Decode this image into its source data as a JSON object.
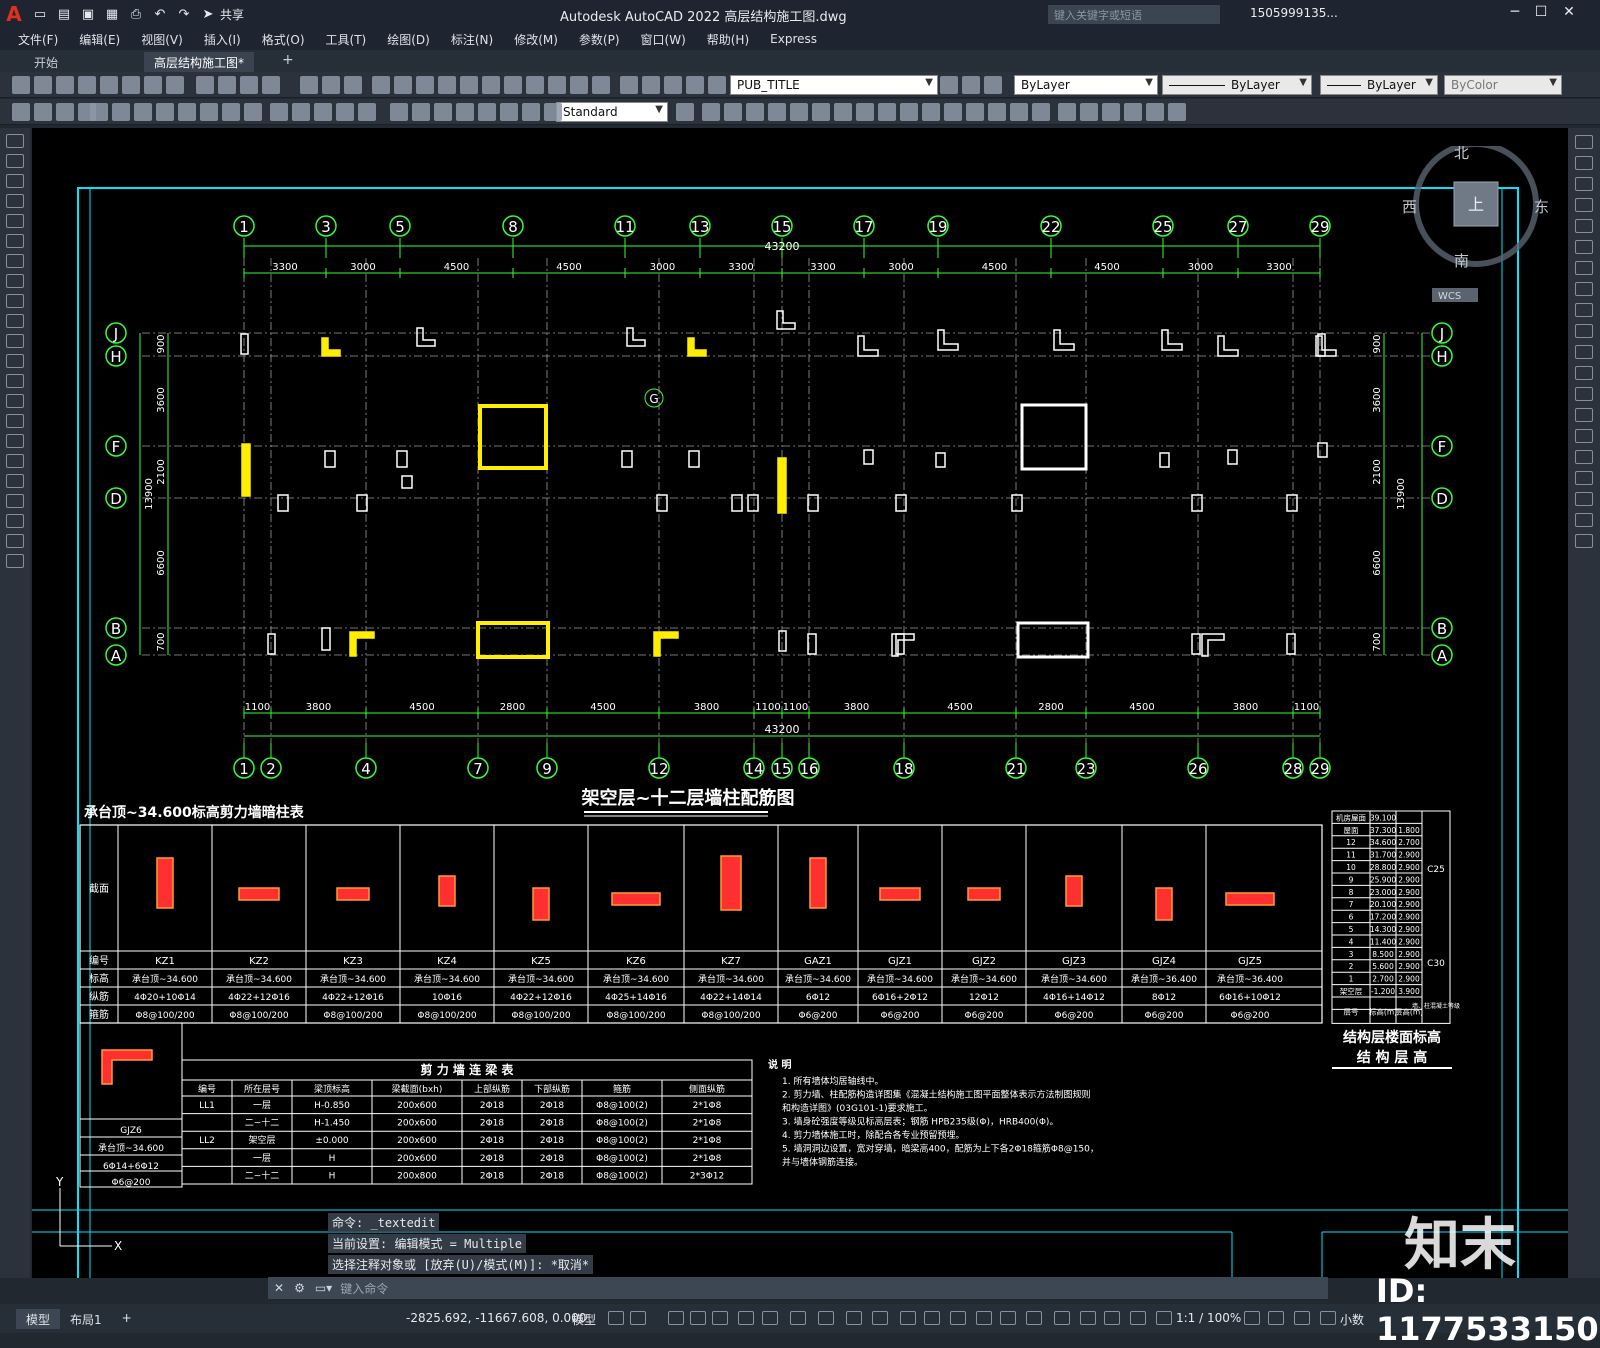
{
  "app": {
    "title": "Autodesk AutoCAD 2022    高层结构施工图.dwg",
    "search_placeholder": "键入关键字或短语",
    "user": "1505999135...",
    "share_label": "共享"
  },
  "menu": [
    "文件(F)",
    "编辑(E)",
    "视图(V)",
    "插入(I)",
    "格式(O)",
    "工具(T)",
    "绘图(D)",
    "标注(N)",
    "修改(M)",
    "参数(P)",
    "窗口(W)",
    "帮助(H)",
    "Express"
  ],
  "tabs": [
    {
      "label": "开始"
    },
    {
      "label": "高层结构施工图*"
    }
  ],
  "toolbar": {
    "layer": "PUB_TITLE",
    "color": "ByLayer",
    "linetype": "ByLayer",
    "lineweight": "ByLayer",
    "plotstyle": "ByColor",
    "textstyle": "Standard"
  },
  "viewcube": {
    "north": "北",
    "south": "南",
    "east": "东",
    "west": "西",
    "top": "上",
    "wcs": "WCS"
  },
  "drawing": {
    "axes_top": [
      "1",
      "3",
      "5",
      "8",
      "11",
      "13",
      "15",
      "17",
      "19",
      "22",
      "25",
      "27",
      "29"
    ],
    "axes_bottom": [
      "1",
      "2",
      "4",
      "7",
      "9",
      "12",
      "14",
      "15",
      "16",
      "18",
      "21",
      "23",
      "26",
      "28",
      "29"
    ],
    "axes_left": [
      "J",
      "H",
      "F",
      "D",
      "B",
      "A"
    ],
    "top_dims": [
      "3300",
      "3000",
      "4500",
      "4500",
      "3000",
      "3300",
      "3300",
      "3000",
      "4500",
      "4500",
      "3000",
      "3300"
    ],
    "top_total": "43200",
    "bottom_dims": [
      "1100",
      "3800",
      "4500",
      "2800",
      "4500",
      "3800",
      "1100",
      "1100",
      "3800",
      "4500",
      "2800",
      "4500",
      "3800",
      "1100"
    ],
    "bottom_total": "43200",
    "left_dims": [
      "900",
      "3600",
      "2100",
      "6600",
      "700"
    ],
    "left_total": "13900",
    "plan_title": "架空层~十二层墙柱配筋图",
    "schedule_title": "承台顶~34.600标高剪力墙暗柱表",
    "schedule_rows": [
      "截面",
      "编号",
      "标高",
      "纵筋",
      "箍筋"
    ],
    "columns": [
      {
        "id": "KZ1",
        "elev": "承台顶~34.600",
        "long": "4Φ20+10Φ14",
        "stir": "Φ8@100/200"
      },
      {
        "id": "KZ2",
        "elev": "承台顶~34.600",
        "long": "4Φ22+12Φ16",
        "stir": "Φ8@100/200"
      },
      {
        "id": "KZ3",
        "elev": "承台顶~34.600",
        "long": "4Φ22+12Φ16",
        "stir": "Φ8@100/200"
      },
      {
        "id": "KZ4",
        "elev": "承台顶~34.600",
        "long": "10Φ16",
        "stir": "Φ8@100/200"
      },
      {
        "id": "KZ5",
        "elev": "承台顶~34.600",
        "long": "4Φ22+12Φ16",
        "stir": "Φ8@100/200"
      },
      {
        "id": "KZ6",
        "elev": "承台顶~34.600",
        "long": "4Φ25+14Φ16",
        "stir": "Φ8@100/200"
      },
      {
        "id": "KZ7",
        "elev": "承台顶~34.600",
        "long": "4Φ22+14Φ14",
        "stir": "Φ8@100/200"
      },
      {
        "id": "GAZ1",
        "elev": "承台顶~34.600",
        "long": "6Φ12",
        "stir": "Φ6@200"
      },
      {
        "id": "GJZ1",
        "elev": "承台顶~34.600",
        "long": "6Φ16+2Φ12",
        "stir": "Φ6@200"
      },
      {
        "id": "GJZ2",
        "elev": "承台顶~34.600",
        "long": "12Φ12",
        "stir": "Φ6@200"
      },
      {
        "id": "GJZ3",
        "elev": "承台顶~34.600",
        "long": "4Φ16+14Φ12",
        "stir": "Φ6@200"
      },
      {
        "id": "GJZ4",
        "elev": "承台顶~36.400",
        "long": "8Φ12",
        "stir": "Φ6@200"
      },
      {
        "id": "GJZ5",
        "elev": "承台顶~36.400",
        "long": "6Φ16+10Φ12",
        "stir": "Φ6@200"
      }
    ],
    "gjz6": {
      "id": "GJZ6",
      "elev": "承台顶~34.600",
      "long": "6Φ14+6Φ12",
      "stir": "Φ6@200"
    },
    "beam_table": {
      "title": "剪 力 墙 连 梁 表",
      "headers": [
        "编号",
        "所在层号",
        "梁顶标高",
        "梁截面(bxh)",
        "上部纵筋",
        "下部纵筋",
        "箍筋",
        "侧面纵筋"
      ],
      "rows": [
        [
          "LL1",
          "一层",
          "H-0.850",
          "200x600",
          "2Φ18",
          "2Φ18",
          "Φ8@100(2)",
          "2*1Φ8"
        ],
        [
          "",
          "二~十二",
          "H-1.450",
          "200x600",
          "2Φ18",
          "2Φ18",
          "Φ8@100(2)",
          "2*1Φ8"
        ],
        [
          "LL2",
          "架空层",
          "±0.000",
          "200x600",
          "2Φ18",
          "2Φ18",
          "Φ8@100(2)",
          "2*1Φ8"
        ],
        [
          "",
          "一层",
          "H",
          "200x600",
          "2Φ18",
          "2Φ18",
          "Φ8@100(2)",
          "2*1Φ8"
        ],
        [
          "",
          "二~十二",
          "H",
          "200x800",
          "2Φ18",
          "2Φ18",
          "Φ8@100(2)",
          "2*3Φ12"
        ]
      ]
    },
    "notes_title": "说 明",
    "notes": [
      "1. 所有墙体均居轴线中。",
      "2. 剪力墙、柱配筋构造详图集《混凝土结构施工图平面整体表示方法制图规则",
      "   和构造详图》(03G101-1)要求施工。",
      "3. 墙身砼强度等级见标高层表；钢筋 HPB235级(Φ)，HRB400(Φ)。",
      "4. 剪力墙体施工时，除配合各专业预留预埋。",
      "5. 墙洞洞边设置，宽对穿墙，暗梁高400，配筋为上下各2Φ18箍筋Φ8@150，",
      "   并与墙体钢筋连接。"
    ],
    "levels": {
      "title": "结构层楼面标高",
      "subtitle": "结 构 层 高",
      "rows": [
        [
          "机房屋面",
          "39.100",
          ""
        ],
        [
          "屋面",
          "37.300",
          "1.800"
        ],
        [
          "12",
          "34.600",
          "2.700"
        ],
        [
          "11",
          "31.700",
          "2.900"
        ],
        [
          "10",
          "28.800",
          "2.900"
        ],
        [
          "9",
          "25.900",
          "2.900"
        ],
        [
          "8",
          "23.000",
          "2.900"
        ],
        [
          "7",
          "20.100",
          "2.900"
        ],
        [
          "6",
          "17.200",
          "2.900"
        ],
        [
          "5",
          "14.300",
          "2.900"
        ],
        [
          "4",
          "11.400",
          "2.900"
        ],
        [
          "3",
          "8.500",
          "2.900"
        ],
        [
          "2",
          "5.600",
          "2.900"
        ],
        [
          "1",
          "2.700",
          "2.900"
        ],
        [
          "架空层",
          "-1.200",
          "3.900"
        ],
        [
          "层号",
          "标高(m)",
          "层高(m)"
        ]
      ],
      "grade_upper": "C25",
      "grade_lower": "C30",
      "grade_col": "墙、柱混凝土等级"
    }
  },
  "command": {
    "history": [
      "命令: _textedit",
      "当前设置: 编辑模式 = Multiple",
      "选择注释对象或 [放弃(U)/模式(M)]: *取消*"
    ],
    "placeholder": "键入命令"
  },
  "status": {
    "tabs": [
      "模型",
      "布局1"
    ],
    "coords": "-2825.692, -11667.608, 0.000",
    "space": "模型",
    "scale": "1:1 / 100%",
    "units": "小数"
  },
  "watermark": {
    "id": "ID: 1177533150",
    "logo": "知末"
  }
}
